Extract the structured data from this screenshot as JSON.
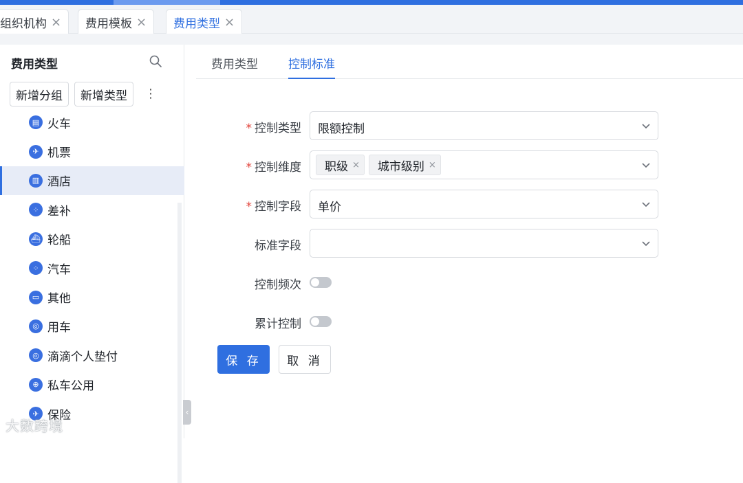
{
  "top_tabs": [
    {
      "label": "组织机构",
      "close": "×"
    },
    {
      "label": "费用模板",
      "close": "×"
    },
    {
      "label": "费用类型",
      "close": "×"
    }
  ],
  "sidebar": {
    "title": "费用类型",
    "buttons": {
      "add_group": "新增分组",
      "add_type": "新增类型",
      "more": "⋮"
    },
    "items": [
      {
        "label": "火车",
        "icon": "train-icon",
        "glyph": "▤"
      },
      {
        "label": "机票",
        "icon": "plane-icon",
        "glyph": "✈"
      },
      {
        "label": "酒店",
        "icon": "hotel-icon",
        "glyph": "▥"
      },
      {
        "label": "差补",
        "icon": "grid-icon",
        "glyph": "⁘"
      },
      {
        "label": "轮船",
        "icon": "ship-icon",
        "glyph": "⛴"
      },
      {
        "label": "汽车",
        "icon": "grid-icon",
        "glyph": "⁘"
      },
      {
        "label": "其他",
        "icon": "car-icon",
        "glyph": "▭"
      },
      {
        "label": "用车",
        "icon": "shield-icon",
        "glyph": "◎"
      },
      {
        "label": "滴滴个人垫付",
        "icon": "shield-icon",
        "glyph": "◎"
      },
      {
        "label": "私车公用",
        "icon": "wheel-icon",
        "glyph": "⊕"
      },
      {
        "label": "保险",
        "icon": "plane-icon",
        "glyph": "✈"
      }
    ],
    "active_index": 2
  },
  "main": {
    "tabs": [
      {
        "label": "费用类型"
      },
      {
        "label": "控制标准"
      }
    ],
    "active_tab": 1,
    "form": {
      "control_type": {
        "label": "控制类型",
        "required": "*",
        "value": "限额控制"
      },
      "control_dimension": {
        "label": "控制维度",
        "required": "*",
        "tags": [
          "职级",
          "城市级别"
        ],
        "tag_close": "×"
      },
      "control_field": {
        "label": "控制字段",
        "required": "*",
        "value": "单价"
      },
      "standard_field": {
        "label": "标准字段",
        "value": ""
      },
      "control_frequency": {
        "label": "控制频次",
        "on": false
      },
      "cumulative_control": {
        "label": "累计控制",
        "on": false
      }
    },
    "actions": {
      "save": "保 存",
      "cancel": "取 消"
    }
  },
  "watermark": "大数跨境",
  "colors": {
    "accent": "#2f6fe0",
    "required": "#e2433b"
  }
}
